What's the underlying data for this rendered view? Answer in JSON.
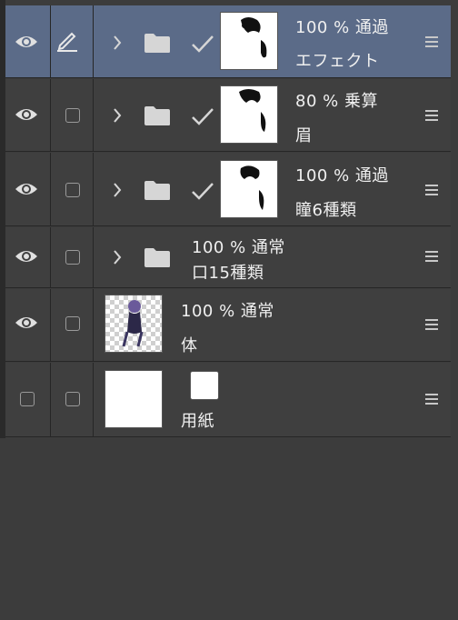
{
  "layers": [
    {
      "opacity": "100 %",
      "blend": "通過",
      "name": "エフェクト",
      "selected": true
    },
    {
      "opacity": "80 %",
      "blend": "乗算",
      "name": "眉"
    },
    {
      "opacity": "100 %",
      "blend": "通過",
      "name": "瞳6種類"
    },
    {
      "opacity": "100 %",
      "blend": "通常",
      "name": "口15種類"
    },
    {
      "opacity": "100 %",
      "blend": "通常",
      "name": "体"
    },
    {
      "opacity": "",
      "blend": "",
      "name": "用紙"
    }
  ],
  "colors": {
    "panel_bg": "#3f3f3f",
    "selected_bg": "#5b6b88",
    "icon": "#d6d6d6"
  }
}
